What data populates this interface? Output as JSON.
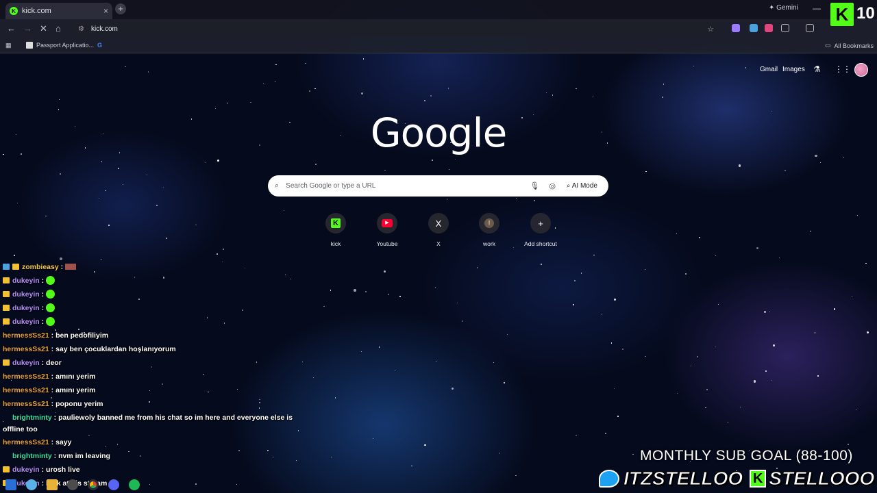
{
  "browser": {
    "tab": {
      "title": "kick.com",
      "close": "×",
      "new_tab": "+"
    },
    "gemini": "✦ Gemini",
    "window_min": "—",
    "url": "kick.com",
    "bookmarks": {
      "item1": "Passport Applicatio...",
      "item2": "G",
      "all": "All Bookmarks"
    }
  },
  "stream_badge": {
    "logo": "K",
    "count": "10"
  },
  "ntp": {
    "gmail": "Gmail",
    "images": "Images",
    "logo": "Google",
    "search_placeholder": "Search Google or type a URL",
    "ai_mode": "AI Mode",
    "shortcuts": [
      {
        "label": "kick",
        "glyph": "K",
        "color": "#53fc18"
      },
      {
        "label": "Youtube",
        "glyph": "▶",
        "color": "#ff0033"
      },
      {
        "label": "X",
        "glyph": "X",
        "color": "#ffffff"
      },
      {
        "label": "work",
        "glyph": "I",
        "color": "#6d5a4a"
      },
      {
        "label": "Add shortcut",
        "glyph": "+",
        "color": "#ffffff"
      }
    ]
  },
  "chat": [
    {
      "user": "zombieasy",
      "text": ""
    },
    {
      "user": "dukeyin",
      "text": ""
    },
    {
      "user": "dukeyin",
      "text": ""
    },
    {
      "user": "dukeyin",
      "text": ""
    },
    {
      "user": "dukeyin",
      "text": ""
    },
    {
      "user": "hermessSs21",
      "text": "ben pedofiliyim"
    },
    {
      "user": "hermessSs21",
      "text": "say ben çocuklardan hoşlanıyorum"
    },
    {
      "user": "dukeyin",
      "text": "deor"
    },
    {
      "user": "hermessSs21",
      "text": "amını yerim"
    },
    {
      "user": "hermessSs21",
      "text": "amını yerim"
    },
    {
      "user": "hermessSs21",
      "text": "poponu yerim"
    },
    {
      "user": "brightminty",
      "text": "pauliewoly banned me from his chat so im here and everyone else is offline too"
    },
    {
      "user": "hermessSs21",
      "text": "sayy"
    },
    {
      "user": "brightminty",
      "text": "nvm im leaving"
    },
    {
      "user": "dukeyin",
      "text": "urosh live"
    },
    {
      "user": "dukeyin",
      "text": "look at his stream"
    }
  ],
  "overlay": {
    "sub_goal": "MONTHLY SUB GOAL (88-100)",
    "twitter": "ITZSTELLOO",
    "kick_letter": "K",
    "kick": "STELLOOO"
  }
}
